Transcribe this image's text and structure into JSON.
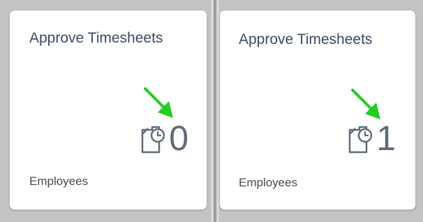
{
  "tiles": [
    {
      "title": "Approve Timesheets",
      "value": "0",
      "footer": "Employees",
      "icon": "document-clock-icon"
    },
    {
      "title": "Approve Timesheets",
      "value": "1",
      "footer": "Employees",
      "icon": "document-clock-icon"
    }
  ],
  "colors": {
    "title": "#3a4a66",
    "value": "#5f6b78",
    "arrow": "#22cc22",
    "background": "#c4c4c4"
  }
}
